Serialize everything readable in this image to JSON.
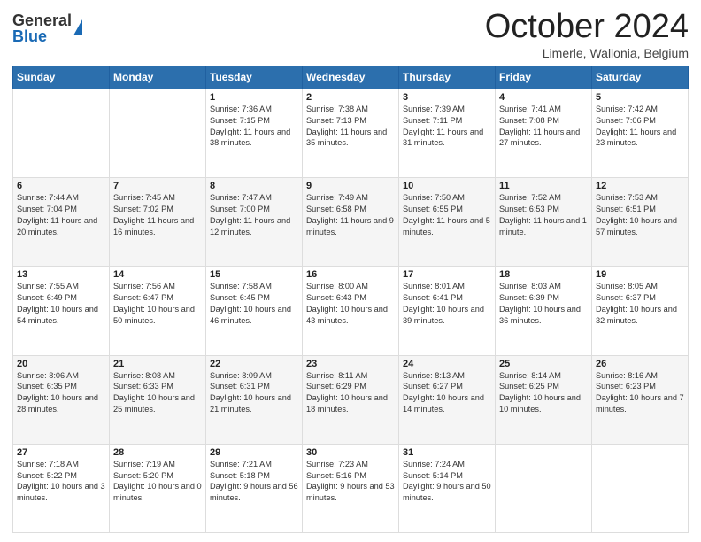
{
  "logo": {
    "general": "General",
    "blue": "Blue"
  },
  "header": {
    "month": "October 2024",
    "location": "Limerle, Wallonia, Belgium"
  },
  "weekdays": [
    "Sunday",
    "Monday",
    "Tuesday",
    "Wednesday",
    "Thursday",
    "Friday",
    "Saturday"
  ],
  "weeks": [
    [
      {
        "day": "",
        "sunrise": "",
        "sunset": "",
        "daylight": ""
      },
      {
        "day": "",
        "sunrise": "",
        "sunset": "",
        "daylight": ""
      },
      {
        "day": "1",
        "sunrise": "Sunrise: 7:36 AM",
        "sunset": "Sunset: 7:15 PM",
        "daylight": "Daylight: 11 hours and 38 minutes."
      },
      {
        "day": "2",
        "sunrise": "Sunrise: 7:38 AM",
        "sunset": "Sunset: 7:13 PM",
        "daylight": "Daylight: 11 hours and 35 minutes."
      },
      {
        "day": "3",
        "sunrise": "Sunrise: 7:39 AM",
        "sunset": "Sunset: 7:11 PM",
        "daylight": "Daylight: 11 hours and 31 minutes."
      },
      {
        "day": "4",
        "sunrise": "Sunrise: 7:41 AM",
        "sunset": "Sunset: 7:08 PM",
        "daylight": "Daylight: 11 hours and 27 minutes."
      },
      {
        "day": "5",
        "sunrise": "Sunrise: 7:42 AM",
        "sunset": "Sunset: 7:06 PM",
        "daylight": "Daylight: 11 hours and 23 minutes."
      }
    ],
    [
      {
        "day": "6",
        "sunrise": "Sunrise: 7:44 AM",
        "sunset": "Sunset: 7:04 PM",
        "daylight": "Daylight: 11 hours and 20 minutes."
      },
      {
        "day": "7",
        "sunrise": "Sunrise: 7:45 AM",
        "sunset": "Sunset: 7:02 PM",
        "daylight": "Daylight: 11 hours and 16 minutes."
      },
      {
        "day": "8",
        "sunrise": "Sunrise: 7:47 AM",
        "sunset": "Sunset: 7:00 PM",
        "daylight": "Daylight: 11 hours and 12 minutes."
      },
      {
        "day": "9",
        "sunrise": "Sunrise: 7:49 AM",
        "sunset": "Sunset: 6:58 PM",
        "daylight": "Daylight: 11 hours and 9 minutes."
      },
      {
        "day": "10",
        "sunrise": "Sunrise: 7:50 AM",
        "sunset": "Sunset: 6:55 PM",
        "daylight": "Daylight: 11 hours and 5 minutes."
      },
      {
        "day": "11",
        "sunrise": "Sunrise: 7:52 AM",
        "sunset": "Sunset: 6:53 PM",
        "daylight": "Daylight: 11 hours and 1 minute."
      },
      {
        "day": "12",
        "sunrise": "Sunrise: 7:53 AM",
        "sunset": "Sunset: 6:51 PM",
        "daylight": "Daylight: 10 hours and 57 minutes."
      }
    ],
    [
      {
        "day": "13",
        "sunrise": "Sunrise: 7:55 AM",
        "sunset": "Sunset: 6:49 PM",
        "daylight": "Daylight: 10 hours and 54 minutes."
      },
      {
        "day": "14",
        "sunrise": "Sunrise: 7:56 AM",
        "sunset": "Sunset: 6:47 PM",
        "daylight": "Daylight: 10 hours and 50 minutes."
      },
      {
        "day": "15",
        "sunrise": "Sunrise: 7:58 AM",
        "sunset": "Sunset: 6:45 PM",
        "daylight": "Daylight: 10 hours and 46 minutes."
      },
      {
        "day": "16",
        "sunrise": "Sunrise: 8:00 AM",
        "sunset": "Sunset: 6:43 PM",
        "daylight": "Daylight: 10 hours and 43 minutes."
      },
      {
        "day": "17",
        "sunrise": "Sunrise: 8:01 AM",
        "sunset": "Sunset: 6:41 PM",
        "daylight": "Daylight: 10 hours and 39 minutes."
      },
      {
        "day": "18",
        "sunrise": "Sunrise: 8:03 AM",
        "sunset": "Sunset: 6:39 PM",
        "daylight": "Daylight: 10 hours and 36 minutes."
      },
      {
        "day": "19",
        "sunrise": "Sunrise: 8:05 AM",
        "sunset": "Sunset: 6:37 PM",
        "daylight": "Daylight: 10 hours and 32 minutes."
      }
    ],
    [
      {
        "day": "20",
        "sunrise": "Sunrise: 8:06 AM",
        "sunset": "Sunset: 6:35 PM",
        "daylight": "Daylight: 10 hours and 28 minutes."
      },
      {
        "day": "21",
        "sunrise": "Sunrise: 8:08 AM",
        "sunset": "Sunset: 6:33 PM",
        "daylight": "Daylight: 10 hours and 25 minutes."
      },
      {
        "day": "22",
        "sunrise": "Sunrise: 8:09 AM",
        "sunset": "Sunset: 6:31 PM",
        "daylight": "Daylight: 10 hours and 21 minutes."
      },
      {
        "day": "23",
        "sunrise": "Sunrise: 8:11 AM",
        "sunset": "Sunset: 6:29 PM",
        "daylight": "Daylight: 10 hours and 18 minutes."
      },
      {
        "day": "24",
        "sunrise": "Sunrise: 8:13 AM",
        "sunset": "Sunset: 6:27 PM",
        "daylight": "Daylight: 10 hours and 14 minutes."
      },
      {
        "day": "25",
        "sunrise": "Sunrise: 8:14 AM",
        "sunset": "Sunset: 6:25 PM",
        "daylight": "Daylight: 10 hours and 10 minutes."
      },
      {
        "day": "26",
        "sunrise": "Sunrise: 8:16 AM",
        "sunset": "Sunset: 6:23 PM",
        "daylight": "Daylight: 10 hours and 7 minutes."
      }
    ],
    [
      {
        "day": "27",
        "sunrise": "Sunrise: 7:18 AM",
        "sunset": "Sunset: 5:22 PM",
        "daylight": "Daylight: 10 hours and 3 minutes."
      },
      {
        "day": "28",
        "sunrise": "Sunrise: 7:19 AM",
        "sunset": "Sunset: 5:20 PM",
        "daylight": "Daylight: 10 hours and 0 minutes."
      },
      {
        "day": "29",
        "sunrise": "Sunrise: 7:21 AM",
        "sunset": "Sunset: 5:18 PM",
        "daylight": "Daylight: 9 hours and 56 minutes."
      },
      {
        "day": "30",
        "sunrise": "Sunrise: 7:23 AM",
        "sunset": "Sunset: 5:16 PM",
        "daylight": "Daylight: 9 hours and 53 minutes."
      },
      {
        "day": "31",
        "sunrise": "Sunrise: 7:24 AM",
        "sunset": "Sunset: 5:14 PM",
        "daylight": "Daylight: 9 hours and 50 minutes."
      },
      {
        "day": "",
        "sunrise": "",
        "sunset": "",
        "daylight": ""
      },
      {
        "day": "",
        "sunrise": "",
        "sunset": "",
        "daylight": ""
      }
    ]
  ]
}
